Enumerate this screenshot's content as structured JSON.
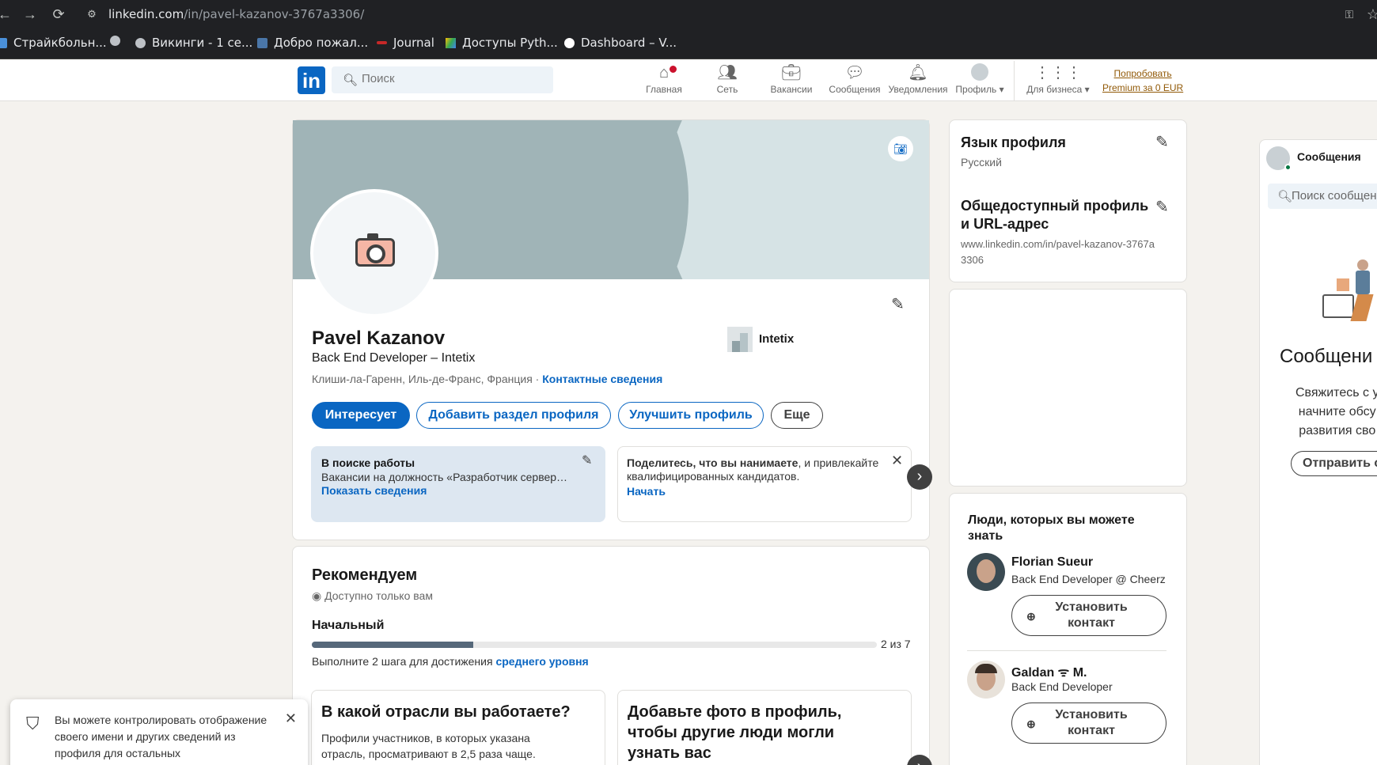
{
  "browser": {
    "url_host": "linkedin.com",
    "url_path": "/in/pavel-kazanov-3767a3306/",
    "bookmarks": [
      "Страйкбольн...",
      "Викинги - 1 се...",
      "Добро пожал...",
      "Journal",
      "Доступы Pyth...",
      "Dashboard – V..."
    ]
  },
  "header": {
    "logo": "in",
    "search_placeholder": "Поиск",
    "nav": {
      "home": "Главная",
      "network": "Сеть",
      "jobs": "Вакансии",
      "messages": "Сообщения",
      "notifications": "Уведомления",
      "profile": "Профиль",
      "business": "Для бизнеса"
    },
    "premium_line1": "Попробовать",
    "premium_line2": "Premium за 0 EUR"
  },
  "profile": {
    "name": "Pavel Kazanov",
    "headline": "Back End Developer – Intetix",
    "location": "Клиши-ла-Гаренн, Иль-де-Франс, Франция",
    "separator": " · ",
    "contact_link": "Контактные сведения",
    "company": "Intetix",
    "buttons": {
      "open_to": "Интересует",
      "add_section": "Добавить раздел профиля",
      "enhance": "Улучшить профиль",
      "more": "Еще"
    },
    "open_to_work": {
      "title": "В поиске работы",
      "text": "Вакансии на должность «Разработчик сервер…",
      "link": "Показать сведения"
    },
    "hiring": {
      "text_bold": "Поделитесь, что вы нанимаете",
      "text_rest": ", и привлекайте квалифицированных кандидатов.",
      "link": "Начать"
    }
  },
  "recommended": {
    "title": "Рекомендуем",
    "private": "Доступно только вам",
    "level": "Начальный",
    "progress": 0.2857,
    "progress_label": "2 из 7",
    "hint_prefix": "Выполните 2 шага для достижения ",
    "hint_link": "среднего уровня",
    "cards": [
      {
        "title": "В какой отрасли вы работаете?",
        "text": "Профили участников, в которых указана отрасль, просматривают в 2,5 раза чаще."
      },
      {
        "title": "Добавьте фото в профиль, чтобы другие люди могли узнать вас",
        "text": ""
      }
    ]
  },
  "sidebar": {
    "language_title": "Язык профиля",
    "language_value": "Русский",
    "public_title": "Общедоступный профиль и URL-адрес",
    "public_url": "www.linkedin.com/in/pavel-kazanov-3767a3306",
    "pymk_title": "Люди, которых вы можете знать",
    "people": [
      {
        "name": "Florian Sueur",
        "title": "Back End Developer @ Cheerz",
        "action": "Установить контакт"
      },
      {
        "name": "Galdan ᯤ M.",
        "title": "Back End Developer",
        "action": "Установить контакт"
      }
    ]
  },
  "messaging": {
    "title": "Сообщения",
    "search_placeholder": "Поиск сообщени",
    "heading": "Сообщени",
    "text_lines": [
      "Свяжитесь с у",
      "начните обсу",
      "развития сво"
    ],
    "send_button": "Отправить с"
  },
  "toast": {
    "text": "Вы можете контролировать отображение своего имени и других сведений из профиля для остальных"
  },
  "colors": {
    "brand": "#0a66c2",
    "premium": "#915907",
    "notification_badge": "#cb112d"
  }
}
